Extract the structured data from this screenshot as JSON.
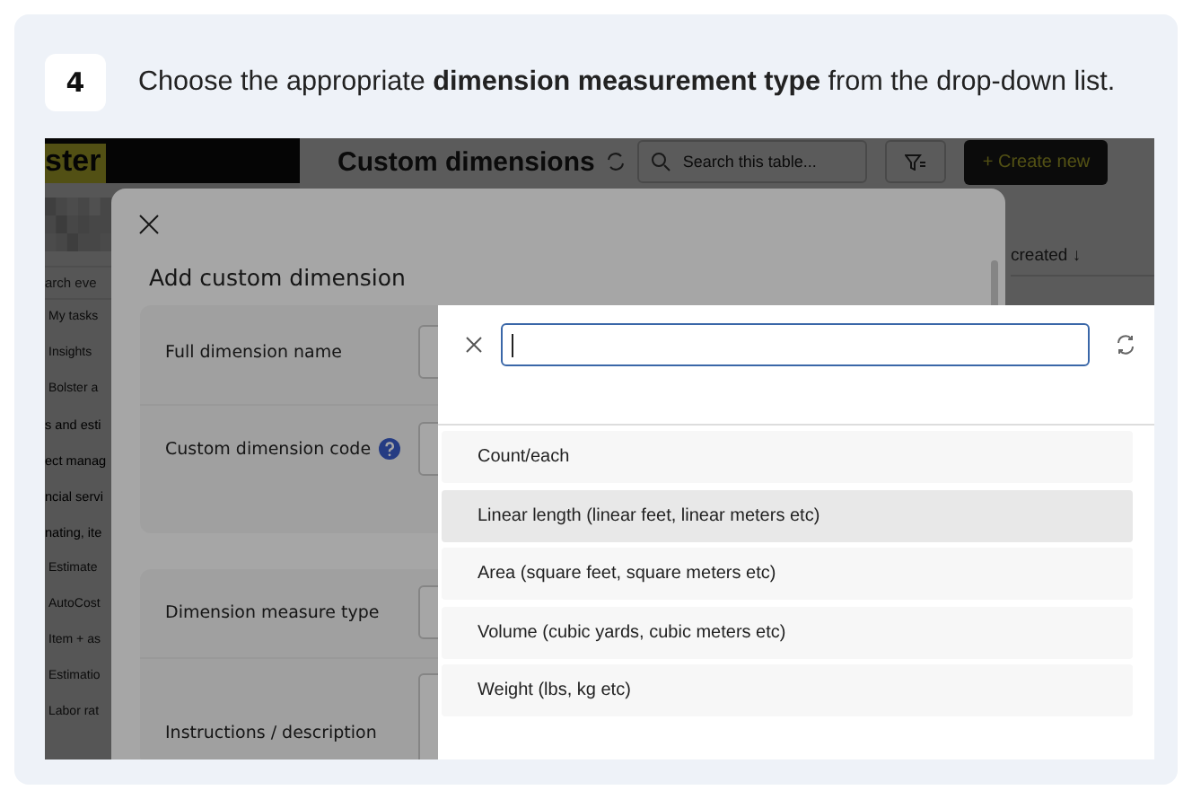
{
  "step": {
    "number": "4",
    "instruction": "Choose the appropriate **dimension measurement type** from the drop-down list."
  },
  "app": {
    "logo": "ster",
    "sidebar": {
      "search_placeholder": "arch eve",
      "items": [
        {
          "label": "My tasks",
          "kind": "item"
        },
        {
          "label": "Insights",
          "kind": "item"
        },
        {
          "label": "Bolster a",
          "kind": "item"
        },
        {
          "label": "s and esti",
          "kind": "section"
        },
        {
          "label": "ect manag",
          "kind": "section"
        },
        {
          "label": "ncial servi",
          "kind": "section"
        },
        {
          "label": "nating, ite",
          "kind": "section"
        },
        {
          "label": "Estimate",
          "kind": "item"
        },
        {
          "label": "AutoCost",
          "kind": "item"
        },
        {
          "label": "Item + as",
          "kind": "item"
        },
        {
          "label": "Estimatio",
          "kind": "item"
        },
        {
          "label": "Labor rat",
          "kind": "item"
        }
      ]
    },
    "header": {
      "title": "Custom dimensions",
      "search_placeholder": "Search this table...",
      "create_button": "+ Create new"
    },
    "table": {
      "sort_column": "created ↓"
    }
  },
  "modal": {
    "title": "Add custom dimension",
    "sections": [
      {
        "fields": [
          {
            "label": "Full dimension name",
            "help": false
          },
          {
            "label": "Custom dimension code",
            "help": true
          }
        ]
      },
      {
        "fields": [
          {
            "label": "Dimension measure type",
            "help": false
          },
          {
            "label": "Instructions / description",
            "help": false
          }
        ]
      }
    ]
  },
  "dropdown": {
    "options": [
      {
        "label": "Count/each",
        "hovered": false
      },
      {
        "label": "Linear length (linear feet, linear meters etc)",
        "hovered": true
      },
      {
        "label": "Area (square feet, square meters etc)",
        "hovered": false
      },
      {
        "label": "Volume (cubic yards, cubic meters etc)",
        "hovered": false
      },
      {
        "label": "Weight (lbs, kg etc)",
        "hovered": false
      }
    ]
  }
}
